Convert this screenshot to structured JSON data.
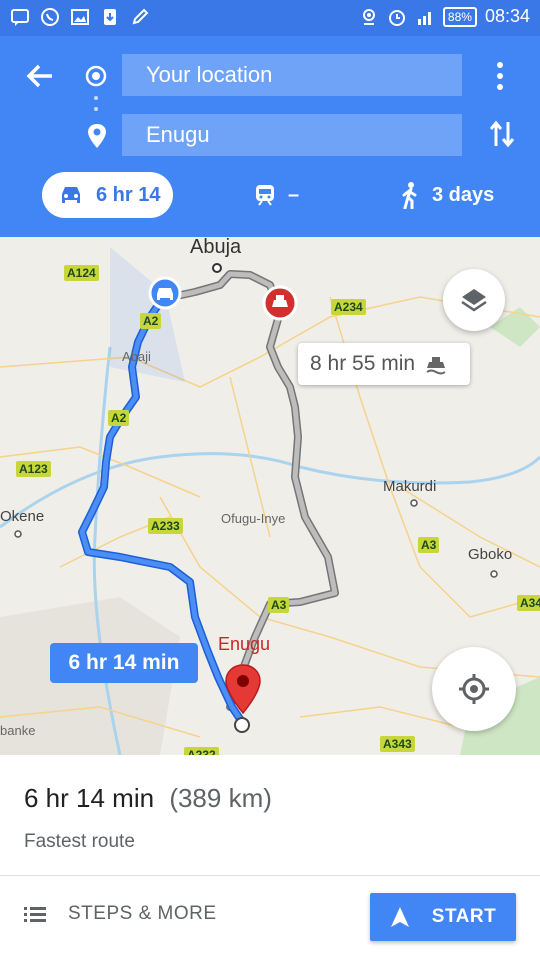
{
  "status_bar": {
    "time": "08:34",
    "battery": "88%",
    "icons": [
      "message-icon",
      "whatsapp-icon",
      "image-icon",
      "download-icon",
      "edit-icon",
      "location-icon",
      "alarm-icon",
      "signal-icon",
      "battery-icon"
    ]
  },
  "header": {
    "origin_placeholder": "Your location",
    "destination": "Enugu",
    "modes": [
      {
        "name": "drive",
        "label": "6 hr 14",
        "selected": true
      },
      {
        "name": "transit",
        "label": "–",
        "selected": false
      },
      {
        "name": "walk",
        "label": "3 days",
        "selected": false
      }
    ]
  },
  "map": {
    "places": [
      "Abuja",
      "Abaji",
      "Makurdi",
      "Okene",
      "Ofugu-Inye",
      "Gboko",
      "Enugu",
      "banke"
    ],
    "road_tags": [
      "A124",
      "A2",
      "A2",
      "A234",
      "A123",
      "A233",
      "A3",
      "A3",
      "A343",
      "A34",
      "A232"
    ],
    "main_route_time": "6 hr 14 min",
    "alt_route_time": "8 hr 55 min",
    "route_color": "#4285f4",
    "alt_route_color": "#9e9e9e"
  },
  "summary": {
    "duration": "6 hr 14 min",
    "distance": "(389 km)",
    "route_desc": "Fastest route",
    "steps_label": "STEPS & MORE",
    "start_label": "START"
  }
}
